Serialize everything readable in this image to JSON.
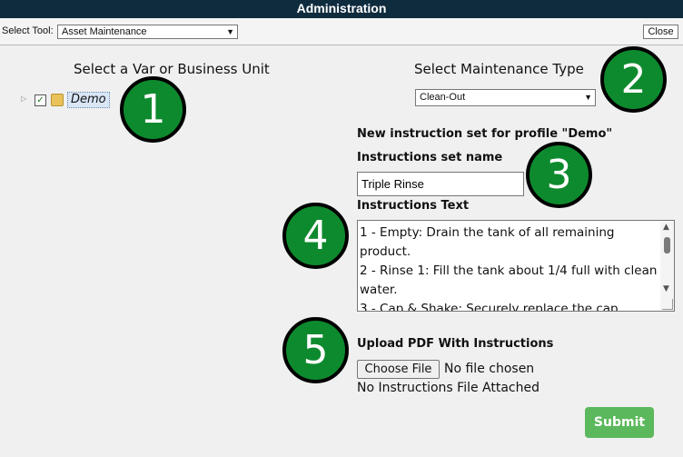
{
  "window": {
    "title": "Administration"
  },
  "toolbar": {
    "select_tool_label": "Select Tool:",
    "selected_tool": "Asset Maintenance",
    "close_label": "Close"
  },
  "left_panel": {
    "heading": "Select a Var or Business Unit",
    "tree": [
      {
        "label": "Demo",
        "checked": true
      }
    ]
  },
  "right_panel": {
    "heading": "Select Maintenance Type",
    "selected_type": "Clean-Out",
    "profile_heading": "New instruction set for profile \"Demo\"",
    "name_label": "Instructions set name",
    "name_value": "Triple Rinse",
    "text_label": "Instructions Text",
    "text_value": "1 - Empty: Drain the tank of all remaining product.\n2 - Rinse 1: Fill the tank about 1/4 full with clean water.\n3 - Cap & Shake: Securely replace the cap",
    "upload_label": "Upload PDF With Instructions",
    "choose_file_label": "Choose File",
    "no_file_label": "No file chosen",
    "attached_status": "No Instructions File Attached",
    "submit_label": "Submit"
  },
  "callouts": [
    "1",
    "2",
    "3",
    "4",
    "5"
  ],
  "colors": {
    "titlebar": "#0f2c3f",
    "callout_fill": "#0e8a2e",
    "submit": "#5cb85c",
    "background": "#f0f0f0"
  },
  "icons": [
    "expand-arrow-icon",
    "checkbox-icon",
    "folder-icon",
    "dropdown-arrow-icon",
    "scroll-up-icon",
    "scroll-down-icon",
    "resize-grip-icon"
  ]
}
